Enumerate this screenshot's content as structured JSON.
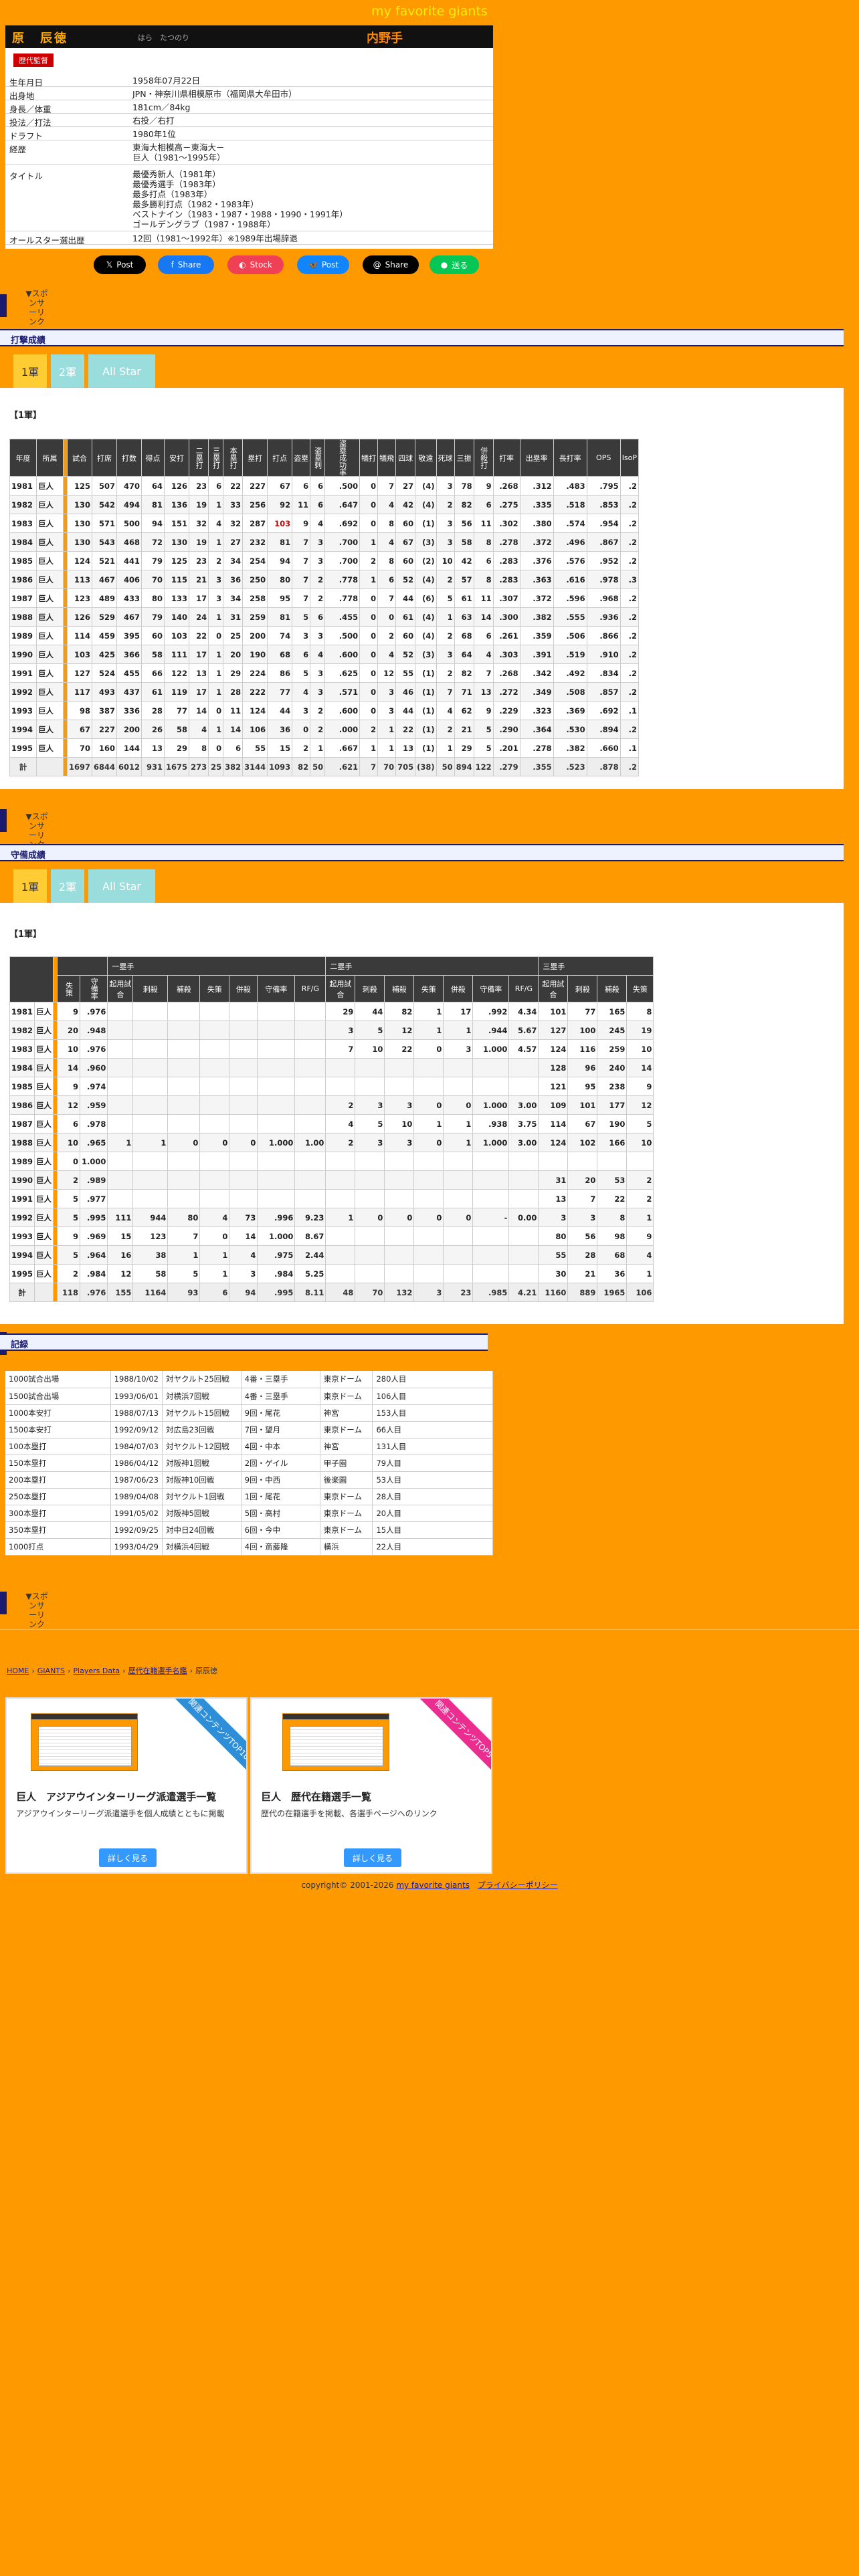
{
  "site_title": "my favorite giants",
  "player": {
    "name": "原　辰徳",
    "kana": "はら　たつのり",
    "position": "内野手",
    "badge": "歴代監督"
  },
  "profile": [
    {
      "k": "生年月日",
      "v": [
        "1958年07月22日"
      ]
    },
    {
      "k": "出身地",
      "v": [
        "JPN・神奈川県相模原市（福岡県大牟田市）"
      ]
    },
    {
      "k": "身長／体重",
      "v": [
        "181cm／84kg"
      ]
    },
    {
      "k": "投法／打法",
      "v": [
        "右投／右打"
      ]
    },
    {
      "k": "ドラフト",
      "v": [
        "1980年1位"
      ]
    },
    {
      "k": "経歴",
      "v": [
        "東海大相模高－東海大－",
        "巨人（1981～1995年）"
      ]
    },
    {
      "k": "タイトル",
      "v": [
        "最優秀新人（1981年）",
        "最優秀選手（1983年）",
        "最多打点（1983年）",
        "最多勝利打点（1982・1983年）",
        "ベストナイン（1983・1987・1988・1990・1991年）",
        "ゴールデングラブ（1987・1988年）"
      ]
    },
    {
      "k": "オールスター選出歴",
      "v": [
        "12回（1981～1992年）※1989年出場辞退"
      ]
    }
  ],
  "share": [
    {
      "label": "Post",
      "icon": "x-icon",
      "color": "#000000"
    },
    {
      "label": "Share",
      "icon": "facebook-icon",
      "color": "#1877f2"
    },
    {
      "label": "Stock",
      "icon": "pocket-icon",
      "color": "#ef4056"
    },
    {
      "label": "Post",
      "icon": "bluesky-icon",
      "color": "#1185fe"
    },
    {
      "label": "Share",
      "icon": "threads-icon",
      "color": "#000000"
    },
    {
      "label": "送る",
      "icon": "line-icon",
      "color": "#06c755"
    }
  ],
  "sponsor_label": "▼スポンサーリンク",
  "batting": {
    "head": "打撃成績",
    "tabs": [
      "1軍",
      "2軍",
      "All Star"
    ],
    "subhead": "【1軍】",
    "columns": [
      "年度",
      "所属",
      "試合",
      "打席",
      "打数",
      "得点",
      "安打",
      "二塁打",
      "三塁打",
      "本塁打",
      "塁打",
      "打点",
      "盗塁",
      "盗塁刺",
      "盗塁成功率",
      "犠打",
      "犠飛",
      "四球",
      "敬遠",
      "死球",
      "三振",
      "併殺打",
      "打率",
      "出塁率",
      "長打率",
      "OPS",
      "IsoP"
    ],
    "rows": [
      [
        "1981",
        "巨人",
        "125",
        "507",
        "470",
        "64",
        "126",
        "23",
        "6",
        "22",
        "227",
        "67",
        "6",
        "6",
        ".500",
        "0",
        "7",
        "27",
        "(4)",
        "3",
        "78",
        "9",
        ".268",
        ".312",
        ".483",
        ".795",
        ".2"
      ],
      [
        "1982",
        "巨人",
        "130",
        "542",
        "494",
        "81",
        "136",
        "19",
        "1",
        "33",
        "256",
        "92",
        "11",
        "6",
        ".647",
        "0",
        "4",
        "42",
        "(4)",
        "2",
        "82",
        "6",
        ".275",
        ".335",
        ".518",
        ".853",
        ".2"
      ],
      [
        "1983",
        "巨人",
        "130",
        "571",
        "500",
        "94",
        "151",
        "32",
        "4",
        "32",
        "287",
        "103",
        "9",
        "4",
        ".692",
        "0",
        "8",
        "60",
        "(1)",
        "3",
        "56",
        "11",
        ".302",
        ".380",
        ".574",
        ".954",
        ".2"
      ],
      [
        "1984",
        "巨人",
        "130",
        "543",
        "468",
        "72",
        "130",
        "19",
        "1",
        "27",
        "232",
        "81",
        "7",
        "3",
        ".700",
        "1",
        "4",
        "67",
        "(3)",
        "3",
        "58",
        "8",
        ".278",
        ".372",
        ".496",
        ".867",
        ".2"
      ],
      [
        "1985",
        "巨人",
        "124",
        "521",
        "441",
        "79",
        "125",
        "23",
        "2",
        "34",
        "254",
        "94",
        "7",
        "3",
        ".700",
        "2",
        "8",
        "60",
        "(2)",
        "10",
        "42",
        "6",
        ".283",
        ".376",
        ".576",
        ".952",
        ".2"
      ],
      [
        "1986",
        "巨人",
        "113",
        "467",
        "406",
        "70",
        "115",
        "21",
        "3",
        "36",
        "250",
        "80",
        "7",
        "2",
        ".778",
        "1",
        "6",
        "52",
        "(4)",
        "2",
        "57",
        "8",
        ".283",
        ".363",
        ".616",
        ".978",
        ".3"
      ],
      [
        "1987",
        "巨人",
        "123",
        "489",
        "433",
        "80",
        "133",
        "17",
        "3",
        "34",
        "258",
        "95",
        "7",
        "2",
        ".778",
        "0",
        "7",
        "44",
        "(6)",
        "5",
        "61",
        "11",
        ".307",
        ".372",
        ".596",
        ".968",
        ".2"
      ],
      [
        "1988",
        "巨人",
        "126",
        "529",
        "467",
        "79",
        "140",
        "24",
        "1",
        "31",
        "259",
        "81",
        "5",
        "6",
        ".455",
        "0",
        "0",
        "61",
        "(4)",
        "1",
        "63",
        "14",
        ".300",
        ".382",
        ".555",
        ".936",
        ".2"
      ],
      [
        "1989",
        "巨人",
        "114",
        "459",
        "395",
        "60",
        "103",
        "22",
        "0",
        "25",
        "200",
        "74",
        "3",
        "3",
        ".500",
        "0",
        "2",
        "60",
        "(4)",
        "2",
        "68",
        "6",
        ".261",
        ".359",
        ".506",
        ".866",
        ".2"
      ],
      [
        "1990",
        "巨人",
        "103",
        "425",
        "366",
        "58",
        "111",
        "17",
        "1",
        "20",
        "190",
        "68",
        "6",
        "4",
        ".600",
        "0",
        "4",
        "52",
        "(3)",
        "3",
        "64",
        "4",
        ".303",
        ".391",
        ".519",
        ".910",
        ".2"
      ],
      [
        "1991",
        "巨人",
        "127",
        "524",
        "455",
        "66",
        "122",
        "13",
        "1",
        "29",
        "224",
        "86",
        "5",
        "3",
        ".625",
        "0",
        "12",
        "55",
        "(1)",
        "2",
        "82",
        "7",
        ".268",
        ".342",
        ".492",
        ".834",
        ".2"
      ],
      [
        "1992",
        "巨人",
        "117",
        "493",
        "437",
        "61",
        "119",
        "17",
        "1",
        "28",
        "222",
        "77",
        "4",
        "3",
        ".571",
        "0",
        "3",
        "46",
        "(1)",
        "7",
        "71",
        "13",
        ".272",
        ".349",
        ".508",
        ".857",
        ".2"
      ],
      [
        "1993",
        "巨人",
        "98",
        "387",
        "336",
        "28",
        "77",
        "14",
        "0",
        "11",
        "124",
        "44",
        "3",
        "2",
        ".600",
        "0",
        "3",
        "44",
        "(1)",
        "4",
        "62",
        "9",
        ".229",
        ".323",
        ".369",
        ".692",
        ".1"
      ],
      [
        "1994",
        "巨人",
        "67",
        "227",
        "200",
        "26",
        "58",
        "4",
        "1",
        "14",
        "106",
        "36",
        "0",
        "2",
        ".000",
        "2",
        "1",
        "22",
        "(1)",
        "2",
        "21",
        "5",
        ".290",
        ".364",
        ".530",
        ".894",
        ".2"
      ],
      [
        "1995",
        "巨人",
        "70",
        "160",
        "144",
        "13",
        "29",
        "8",
        "0",
        "6",
        "55",
        "15",
        "2",
        "1",
        ".667",
        "1",
        "1",
        "13",
        "(1)",
        "1",
        "29",
        "5",
        ".201",
        ".278",
        ".382",
        ".660",
        ".1"
      ]
    ],
    "total": [
      "計",
      "",
      "1697",
      "6844",
      "6012",
      "931",
      "1675",
      "273",
      "25",
      "382",
      "3144",
      "1093",
      "82",
      "50",
      ".621",
      "7",
      "70",
      "705",
      "(38)",
      "50",
      "894",
      "122",
      ".279",
      ".355",
      ".523",
      ".878",
      ".2"
    ]
  },
  "fielding": {
    "head": "守備成績",
    "tabs": [
      "1軍",
      "2軍",
      "All Star"
    ],
    "subhead": "【1軍】",
    "groups": [
      "一塁手",
      "二塁手",
      "三塁手"
    ],
    "columns": [
      "年度",
      "所属",
      "失策",
      "守備率",
      "起用試合",
      "刺殺",
      "補殺",
      "失策",
      "併殺",
      "守備率",
      "RF/G",
      "起用試合",
      "刺殺",
      "補殺",
      "失策",
      "併殺",
      "守備率",
      "RF/G",
      "起用試合",
      "刺殺",
      "補殺",
      "失策"
    ],
    "rows": [
      [
        "1981",
        "巨人",
        "9",
        ".976",
        "",
        "",
        "",
        "",
        "",
        "",
        "",
        "29",
        "44",
        "82",
        "1",
        "17",
        ".992",
        "4.34",
        "101",
        "77",
        "165",
        "8"
      ],
      [
        "1982",
        "巨人",
        "20",
        ".948",
        "",
        "",
        "",
        "",
        "",
        "",
        "",
        "3",
        "5",
        "12",
        "1",
        "1",
        ".944",
        "5.67",
        "127",
        "100",
        "245",
        "19"
      ],
      [
        "1983",
        "巨人",
        "10",
        ".976",
        "",
        "",
        "",
        "",
        "",
        "",
        "",
        "7",
        "10",
        "22",
        "0",
        "3",
        "1.000",
        "4.57",
        "124",
        "116",
        "259",
        "10"
      ],
      [
        "1984",
        "巨人",
        "14",
        ".960",
        "",
        "",
        "",
        "",
        "",
        "",
        "",
        "",
        "",
        "",
        "",
        "",
        "",
        "",
        "128",
        "96",
        "240",
        "14"
      ],
      [
        "1985",
        "巨人",
        "9",
        ".974",
        "",
        "",
        "",
        "",
        "",
        "",
        "",
        "",
        "",
        "",
        "",
        "",
        "",
        "",
        "121",
        "95",
        "238",
        "9"
      ],
      [
        "1986",
        "巨人",
        "12",
        ".959",
        "",
        "",
        "",
        "",
        "",
        "",
        "",
        "2",
        "3",
        "3",
        "0",
        "0",
        "1.000",
        "3.00",
        "109",
        "101",
        "177",
        "12"
      ],
      [
        "1987",
        "巨人",
        "6",
        ".978",
        "",
        "",
        "",
        "",
        "",
        "",
        "",
        "4",
        "5",
        "10",
        "1",
        "1",
        ".938",
        "3.75",
        "114",
        "67",
        "190",
        "5"
      ],
      [
        "1988",
        "巨人",
        "10",
        ".965",
        "1",
        "1",
        "0",
        "0",
        "0",
        "1.000",
        "1.00",
        "2",
        "3",
        "3",
        "0",
        "1",
        "1.000",
        "3.00",
        "124",
        "102",
        "166",
        "10"
      ],
      [
        "1989",
        "巨人",
        "0",
        "1.000",
        "",
        "",
        "",
        "",
        "",
        "",
        "",
        "",
        "",
        "",
        "",
        "",
        "",
        "",
        "",
        "",
        "",
        ""
      ],
      [
        "1990",
        "巨人",
        "2",
        ".989",
        "",
        "",
        "",
        "",
        "",
        "",
        "",
        "",
        "",
        "",
        "",
        "",
        "",
        "",
        "31",
        "20",
        "53",
        "2"
      ],
      [
        "1991",
        "巨人",
        "5",
        ".977",
        "",
        "",
        "",
        "",
        "",
        "",
        "",
        "",
        "",
        "",
        "",
        "",
        "",
        "",
        "13",
        "7",
        "22",
        "2"
      ],
      [
        "1992",
        "巨人",
        "5",
        ".995",
        "111",
        "944",
        "80",
        "4",
        "73",
        ".996",
        "9.23",
        "1",
        "0",
        "0",
        "0",
        "0",
        "-",
        "0.00",
        "3",
        "3",
        "8",
        "1"
      ],
      [
        "1993",
        "巨人",
        "9",
        ".969",
        "15",
        "123",
        "7",
        "0",
        "14",
        "1.000",
        "8.67",
        "",
        "",
        "",
        "",
        "",
        "",
        "",
        "80",
        "56",
        "98",
        "9"
      ],
      [
        "1994",
        "巨人",
        "5",
        ".964",
        "16",
        "38",
        "1",
        "1",
        "4",
        ".975",
        "2.44",
        "",
        "",
        "",
        "",
        "",
        "",
        "",
        "55",
        "28",
        "68",
        "4"
      ],
      [
        "1995",
        "巨人",
        "2",
        ".984",
        "12",
        "58",
        "5",
        "1",
        "3",
        ".984",
        "5.25",
        "",
        "",
        "",
        "",
        "",
        "",
        "",
        "30",
        "21",
        "36",
        "1"
      ]
    ],
    "total": [
      "計",
      "",
      "118",
      ".976",
      "155",
      "1164",
      "93",
      "6",
      "94",
      ".995",
      "8.11",
      "48",
      "70",
      "132",
      "3",
      "23",
      ".985",
      "4.21",
      "1160",
      "889",
      "1965",
      "106"
    ]
  },
  "records": {
    "head": "記録",
    "rows": [
      [
        "1000試合出場",
        "1988/10/02",
        "対ヤクルト25回戦",
        "4番・三塁手",
        "東京ドーム",
        "280人目"
      ],
      [
        "1500試合出場",
        "1993/06/01",
        "対横浜7回戦",
        "4番・三塁手",
        "東京ドーム",
        "106人目"
      ],
      [
        "1000本安打",
        "1988/07/13",
        "対ヤクルト15回戦",
        "9回・尾花",
        "神宮",
        "153人目"
      ],
      [
        "1500本安打",
        "1992/09/12",
        "対広島23回戦",
        "7回・望月",
        "東京ドーム",
        "66人目"
      ],
      [
        "100本塁打",
        "1984/07/03",
        "対ヤクルト12回戦",
        "4回・中本",
        "神宮",
        "131人目"
      ],
      [
        "150本塁打",
        "1986/04/12",
        "対阪神1回戦",
        "2回・ゲイル",
        "甲子園",
        "79人目"
      ],
      [
        "200本塁打",
        "1987/06/23",
        "対阪神10回戦",
        "9回・中西",
        "後楽園",
        "53人目"
      ],
      [
        "250本塁打",
        "1989/04/08",
        "対ヤクルト1回戦",
        "1回・尾花",
        "東京ドーム",
        "28人目"
      ],
      [
        "300本塁打",
        "1991/05/02",
        "対阪神5回戦",
        "5回・高村",
        "東京ドーム",
        "20人目"
      ],
      [
        "350本塁打",
        "1992/09/25",
        "対中日24回戦",
        "6回・今中",
        "東京ドーム",
        "15人目"
      ],
      [
        "1000打点",
        "1993/04/29",
        "対横浜4回戦",
        "4回・斎藤隆",
        "横浜",
        "22人目"
      ]
    ]
  },
  "breadcrumb": [
    "HOME",
    "GIANTS",
    "Players Data",
    "歴代在籍選手名鑑",
    "原辰徳"
  ],
  "cards": [
    {
      "title": "巨人　アジアウインターリーグ派遣選手一覧",
      "desc": "アジアウインターリーグ派遣選手を個人成績とともに掲載",
      "btn": "詳しく見る",
      "ribbon": "関連コンテンツTOP10",
      "ribbon_color": "#2e8fd8"
    },
    {
      "title": "巨人　歴代在籍選手一覧",
      "desc": "歴代の在籍選手を掲載、各選手ページへのリンク",
      "btn": "詳しく見る",
      "ribbon": "関連コンテンツTOP5",
      "ribbon_color": "#ea2d8f"
    }
  ],
  "footer": {
    "copy": "copyright© 2001-2026",
    "site": "my favorite giants",
    "policy": "プライバシーポリシー"
  }
}
